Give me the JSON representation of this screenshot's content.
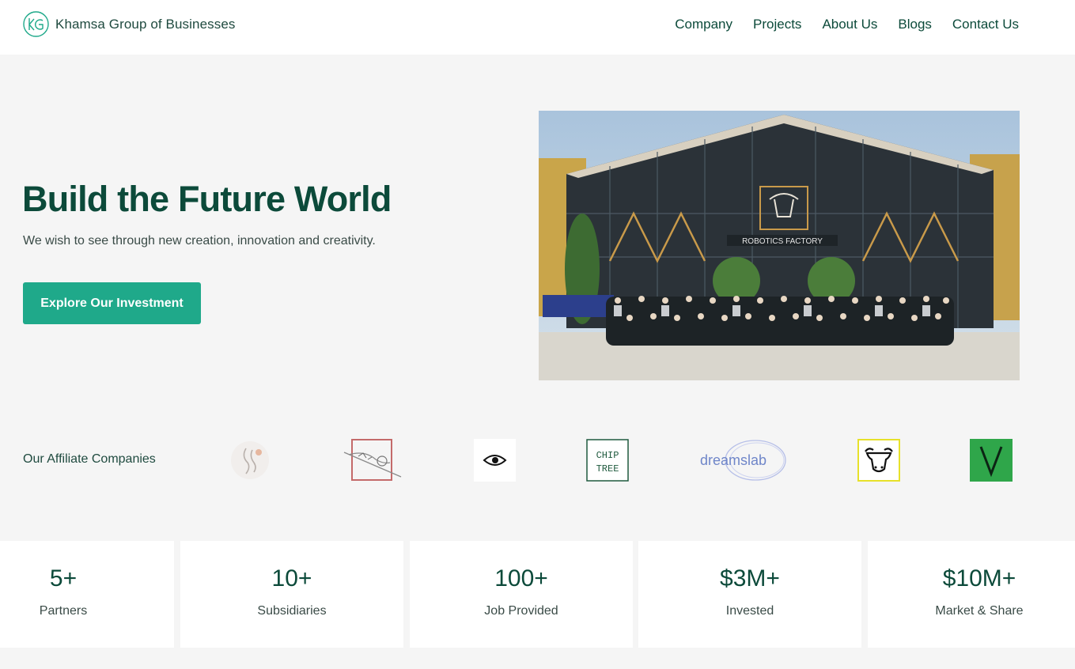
{
  "brand": {
    "name": "Khamsa Group of Businesses",
    "logo_icon": "kg-monogram-icon",
    "accent": "#1fa98a"
  },
  "nav": {
    "items": [
      "Company",
      "Projects",
      "About Us",
      "Blogs",
      "Contact Us"
    ]
  },
  "hero": {
    "title": "Build the Future World",
    "subtitle": "We wish to see through new creation, innovation and creativity.",
    "cta_label": "Explore Our Investment",
    "photo_sign_text": "ROBOTICS FACTORY"
  },
  "affiliates": {
    "label": "Our Affiliate Companies",
    "logos": [
      "ink-circle-logo",
      "framed-sketch-logo",
      "eye-logo",
      "chip-tree-logo",
      "dreamslab-logo",
      "ox-head-logo",
      "green-v-logo"
    ],
    "chip_tree_text": [
      "CHIP",
      "TREE"
    ],
    "dreamslab_text": "dreamslab"
  },
  "stats": [
    {
      "value": "5+",
      "label": "Partners"
    },
    {
      "value": "10+",
      "label": "Subsidiaries"
    },
    {
      "value": "100+",
      "label": "Job Provided"
    },
    {
      "value": "$3M+",
      "label": "Invested"
    },
    {
      "value": "$10M+",
      "label": "Market & Share"
    }
  ]
}
